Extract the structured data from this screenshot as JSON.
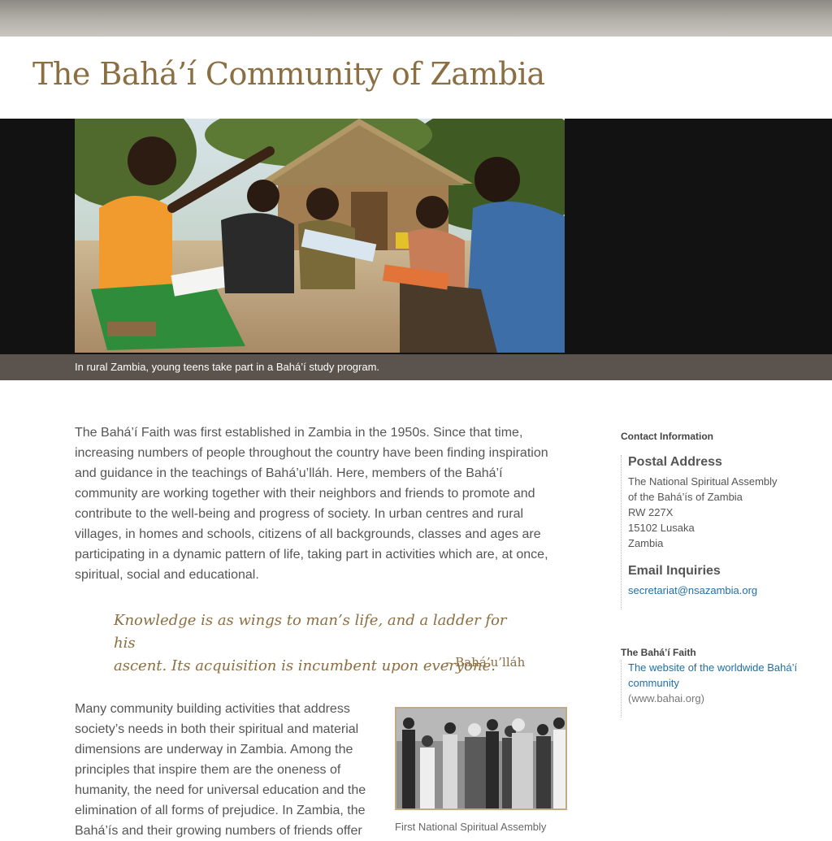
{
  "header": {
    "title": "The Bahá’í Community of Zambia"
  },
  "hero": {
    "caption": "In rural Zambia, young teens take part in a Bahá’í study program."
  },
  "main": {
    "intro": "The Bahá’í Faith was first established in Zambia in the 1950s. Since that time, increasing numbers of people throughout the country have been finding inspiration and guidance in the teachings of Bahá’u’lláh. Here, members of the Bahá’í community are working together with their neighbors and friends to promote and contribute to the well-being and progress of society. In urban centres and rural villages, in homes and schools, citizens of all backgrounds, classes and ages are participating in a dynamic pattern of life, taking part in activities which are, at once, spiritual, social and educational.",
    "quote_line1": "Knowledge is as wings to man’s life, and a ladder for his",
    "quote_line2": "ascent. Its acquisition is incumbent upon everyone.",
    "quote_attribution": "– Bahá’u’lláh",
    "para2": "Many community building activities that address society’s needs in both their spiritual and material dimensions are underway in Zambia. Among the principles that inspire them are the oneness of humanity, the need for universal education and the elimination of all forms of prejudice. In Zambia, the Bahá’ís and their growing numbers of friends offer",
    "figure_caption": "First National Spiritual Assembly"
  },
  "sidebar": {
    "heading": "Contact Information",
    "postal_heading": "Postal Address",
    "address": [
      "The National Spiritual Assembly",
      "of the Bahá’ís of Zambia",
      "RW 227X",
      "15102 Lusaka",
      "Zambia"
    ],
    "email_heading": "Email Inquiries",
    "email": "secretariat@nsazambia.org",
    "faith_heading": "The Bahá’í Faith",
    "faith_link": "The website of the worldwide Bahá’í community",
    "faith_url_text": "(www.bahai.org)"
  },
  "colors": {
    "title": "#8b6f43",
    "link": "#1f6fa6",
    "caption_bar": "#5b534d",
    "hero_bg": "#121212"
  }
}
